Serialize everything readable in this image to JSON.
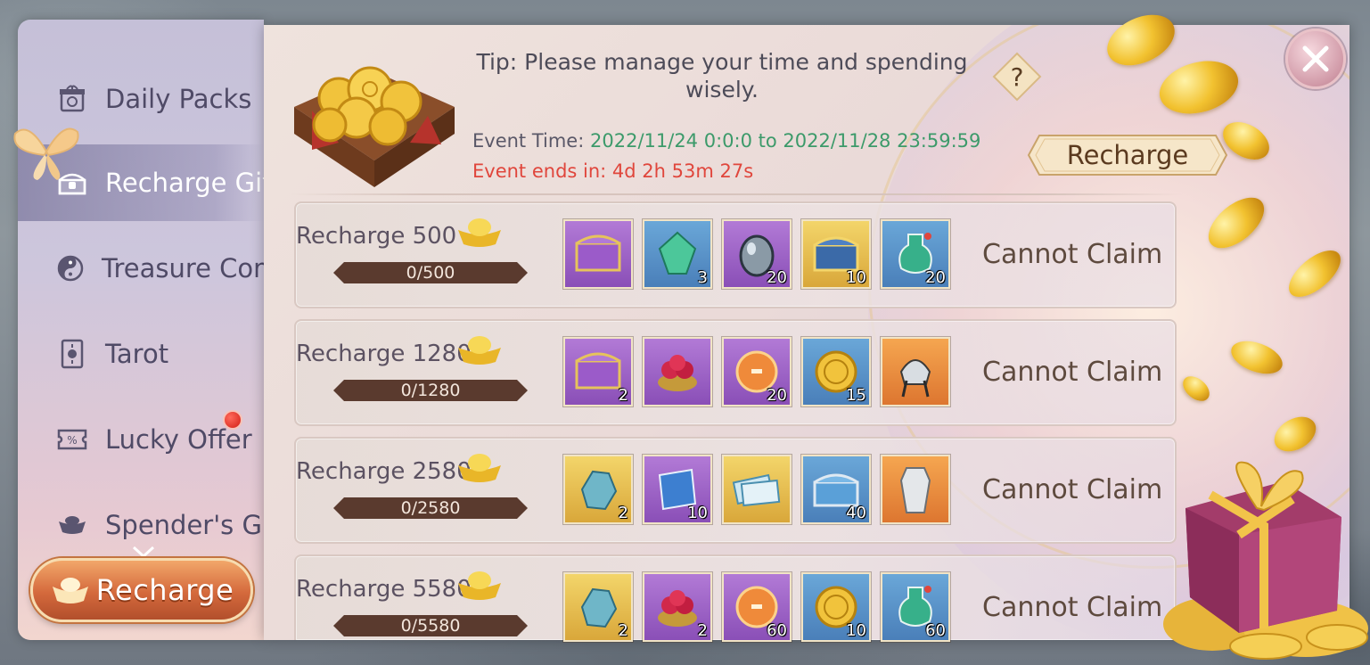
{
  "sidebar": {
    "items": [
      {
        "label": "Daily Packs",
        "icon": "gift-box-icon"
      },
      {
        "label": "Recharge Gift",
        "icon": "chest-icon",
        "active": true
      },
      {
        "label": "Treasure Compass",
        "icon": "yin-yang-icon"
      },
      {
        "label": "Tarot",
        "icon": "tarot-card-icon"
      },
      {
        "label": "Lucky Offer",
        "icon": "coupon-icon",
        "notification": true
      },
      {
        "label": "Spender's Gift",
        "icon": "ingot-icon"
      }
    ],
    "recharge_button": "Recharge"
  },
  "header": {
    "tip": "Tip: Please manage your time and spending wisely.",
    "event_time_label": "Event Time:",
    "event_time_value": "2022/11/24 0:0:0 to 2022/11/28 23:59:59",
    "event_ends": "Event ends in: 4d 2h 53m 27s",
    "recharge_button": "Recharge",
    "help_icon": "?"
  },
  "tiers": [
    {
      "label": "Recharge 500",
      "progress": "0/500",
      "status": "Cannot Claim",
      "rewards": [
        {
          "icon": "purple-chest-icon",
          "rarity": "purple",
          "qty": ""
        },
        {
          "icon": "green-gem-icon",
          "rarity": "blue",
          "qty": "3"
        },
        {
          "icon": "silver-egg-icon",
          "rarity": "purple",
          "qty": "20"
        },
        {
          "icon": "gold-chest-icon",
          "rarity": "gold",
          "qty": "10"
        },
        {
          "icon": "green-potion-icon",
          "rarity": "blue",
          "qty": "20"
        }
      ]
    },
    {
      "label": "Recharge 1280",
      "progress": "0/1280",
      "status": "Cannot Claim",
      "rewards": [
        {
          "icon": "purple-chest-icon",
          "rarity": "purple",
          "qty": "2"
        },
        {
          "icon": "fruit-bowl-icon",
          "rarity": "purple",
          "qty": ""
        },
        {
          "icon": "orange-orb-icon",
          "rarity": "purple",
          "qty": "20"
        },
        {
          "icon": "gold-coin-icon",
          "rarity": "blue",
          "qty": "15"
        },
        {
          "icon": "helmet-icon",
          "rarity": "orange",
          "qty": ""
        }
      ]
    },
    {
      "label": "Recharge 2580",
      "progress": "0/2580",
      "status": "Cannot Claim",
      "rewards": [
        {
          "icon": "blue-crystal-icon",
          "rarity": "gold",
          "qty": "2"
        },
        {
          "icon": "blue-book-icon",
          "rarity": "purple",
          "qty": "10"
        },
        {
          "icon": "tickets-icon",
          "rarity": "gold",
          "qty": ""
        },
        {
          "icon": "silver-chest-icon",
          "rarity": "blue",
          "qty": "40"
        },
        {
          "icon": "armor-icon",
          "rarity": "orange",
          "qty": ""
        }
      ]
    },
    {
      "label": "Recharge 5580",
      "progress": "0/5580",
      "status": "Cannot Claim",
      "rewards": [
        {
          "icon": "blue-crystal-icon",
          "rarity": "gold",
          "qty": "2"
        },
        {
          "icon": "fruit-bowl-icon",
          "rarity": "purple",
          "qty": "2"
        },
        {
          "icon": "orange-orb-icon",
          "rarity": "purple",
          "qty": "60"
        },
        {
          "icon": "gold-coin-icon",
          "rarity": "blue",
          "qty": "10"
        },
        {
          "icon": "green-potion-icon",
          "rarity": "blue",
          "qty": "60"
        }
      ]
    }
  ],
  "colors": {
    "event_time": "#3c9a6a",
    "event_ends": "#e0463c",
    "progress_bar": "#5a3a2e",
    "sidebar_text": "#4f4a66"
  }
}
